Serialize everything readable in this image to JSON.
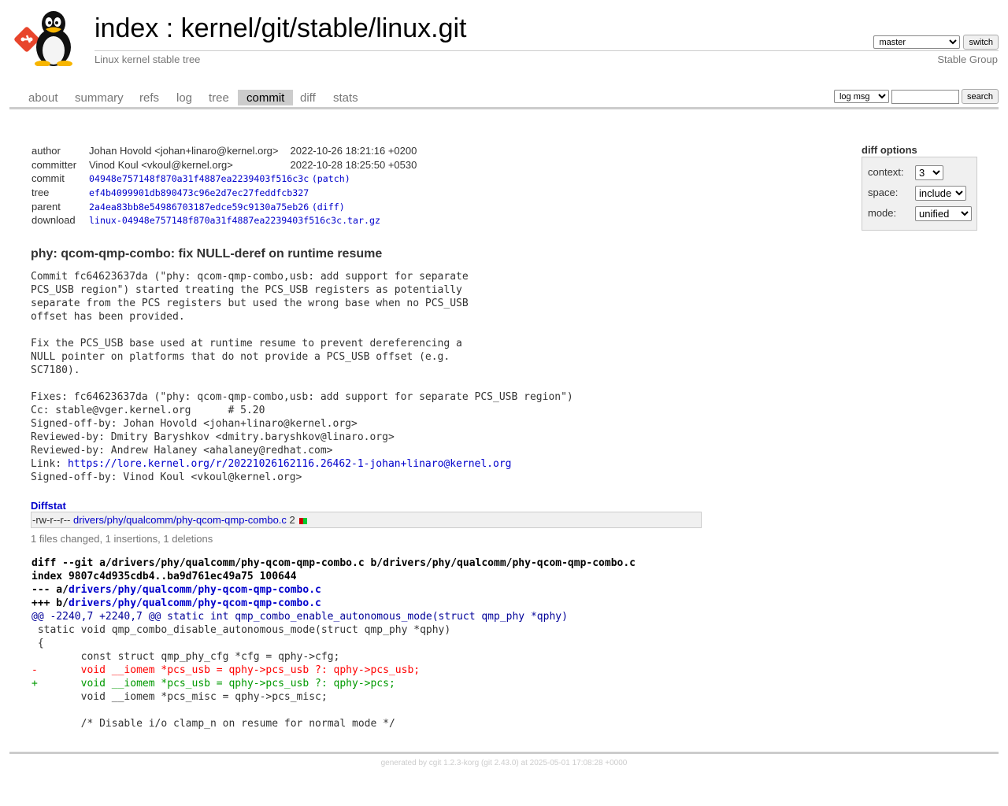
{
  "header": {
    "title_index": "index",
    "title_sep": " : ",
    "title_repo": "kernel/git/stable/linux.git",
    "subtitle": "Linux kernel stable tree",
    "owner": "Stable Group",
    "branch_selected": "master",
    "switch_label": "switch"
  },
  "tabs": [
    {
      "label": "about"
    },
    {
      "label": "summary"
    },
    {
      "label": "refs"
    },
    {
      "label": "log"
    },
    {
      "label": "tree"
    },
    {
      "label": "commit"
    },
    {
      "label": "diff"
    },
    {
      "label": "stats"
    }
  ],
  "search": {
    "type_selected": "log msg",
    "query": "",
    "button_label": "search"
  },
  "commit": {
    "rows": [
      {
        "key": "author",
        "value": "Johan Hovold <johan+linaro@kernel.org>",
        "date": "2022-10-26 18:21:16 +0200"
      },
      {
        "key": "committer",
        "value": "Vinod Koul <vkoul@kernel.org>",
        "date": "2022-10-28 18:25:50 +0530"
      },
      {
        "key": "commit",
        "value": "04948e757148f870a31f4887ea2239403f516c3c",
        "extra": "(patch)"
      },
      {
        "key": "tree",
        "value": "ef4b4099901db890473c96e2d7ec27feddfcb327"
      },
      {
        "key": "parent",
        "value": "2a4ea83bb8e54986703187edce59c9130a75eb26",
        "extra": "(diff)"
      },
      {
        "key": "download",
        "value": "linux-04948e757148f870a31f4887ea2239403f516c3c.tar.gz"
      }
    ],
    "subject": "phy: qcom-qmp-combo: fix NULL-deref on runtime resume",
    "message_pre": "Commit fc64623637da (\"phy: qcom-qmp-combo,usb: add support for separate\nPCS_USB region\") started treating the PCS_USB registers as potentially\nseparate from the PCS registers but used the wrong base when no PCS_USB\noffset has been provided.\n\nFix the PCS_USB base used at runtime resume to prevent dereferencing a\nNULL pointer on platforms that do not provide a PCS_USB offset (e.g.\nSC7180).\n\nFixes: fc64623637da (\"phy: qcom-qmp-combo,usb: add support for separate PCS_USB region\")\nCc: stable@vger.kernel.org\t# 5.20\nSigned-off-by: Johan Hovold <johan+linaro@kernel.org>\nReviewed-by: Dmitry Baryshkov <dmitry.baryshkov@linaro.org>\nReviewed-by: Andrew Halaney <ahalaney@redhat.com>\nLink: ",
    "message_link": "https://lore.kernel.org/r/20221026162116.26462-1-johan+linaro@kernel.org",
    "message_post": "\nSigned-off-by: Vinod Koul <vkoul@kernel.org>"
  },
  "diff_options": {
    "title": "diff options",
    "context_label": "context:",
    "context_value": "3",
    "space_label": "space:",
    "space_value": "include",
    "mode_label": "mode:",
    "mode_value": "unified"
  },
  "diffstat": {
    "title": "Diffstat",
    "mode": "-rw-r--r--",
    "file": "drivers/phy/qualcomm/phy-qcom-qmp-combo.c",
    "count": "2",
    "summary": "1 files changed, 1 insertions, 1 deletions",
    "colors": {
      "del": "#cc0000",
      "ins": "#00cc33"
    }
  },
  "diff": {
    "git_line": "diff --git a/drivers/phy/qualcomm/phy-qcom-qmp-combo.c b/drivers/phy/qualcomm/phy-qcom-qmp-combo.c",
    "index_line": "index 9807c4d935cdb4..ba9d761ec49a75 100644",
    "minus_prefix": "--- a/",
    "plus_prefix": "+++ b/",
    "file_path": "drivers/phy/qualcomm/phy-qcom-qmp-combo.c",
    "lines": [
      {
        "type": "hunk",
        "text": "@@ -2240,7 +2240,7 @@ static int qmp_combo_enable_autonomous_mode(struct qmp_phy *qphy)"
      },
      {
        "type": "ctx",
        "text": " static void qmp_combo_disable_autonomous_mode(struct qmp_phy *qphy)"
      },
      {
        "type": "ctx",
        "text": " {"
      },
      {
        "type": "ctx",
        "text": " \tconst struct qmp_phy_cfg *cfg = qphy->cfg;"
      },
      {
        "type": "del",
        "text": "-\tvoid __iomem *pcs_usb = qphy->pcs_usb ?: qphy->pcs_usb;"
      },
      {
        "type": "add",
        "text": "+\tvoid __iomem *pcs_usb = qphy->pcs_usb ?: qphy->pcs;"
      },
      {
        "type": "ctx",
        "text": " \tvoid __iomem *pcs_misc = qphy->pcs_misc;"
      },
      {
        "type": "ctx",
        "text": " "
      },
      {
        "type": "ctx",
        "text": " \t/* Disable i/o clamp_n on resume for normal mode */"
      }
    ]
  },
  "footer": {
    "prefix": "generated by ",
    "cgit": "cgit 1.2.3-korg",
    "git": " (git 2.43.0) at 2025-05-01 17:08:28 +0000"
  }
}
